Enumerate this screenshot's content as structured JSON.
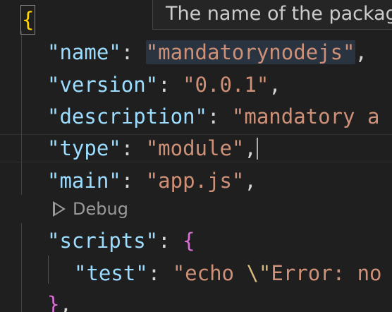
{
  "editor": {
    "hover_tooltip": "The name of the package.",
    "code_lens": {
      "label": "Debug",
      "icon": "debug-play-icon"
    },
    "lines": {
      "open_brace": "{",
      "name": {
        "key": "\"name\"",
        "sep": ": ",
        "value": "\"mandatorynodejs\"",
        "trail": ","
      },
      "version": {
        "key": "\"version\"",
        "sep": ": ",
        "value": "\"0.0.1\"",
        "trail": ","
      },
      "description": {
        "key": "\"description\"",
        "sep": ": ",
        "value": "\"mandatory a"
      },
      "type": {
        "key": "\"type\"",
        "sep": ": ",
        "value": "\"module\"",
        "trail": ","
      },
      "main": {
        "key": "\"main\"",
        "sep": ": ",
        "value": "\"app.js\"",
        "trail": ","
      },
      "scripts": {
        "key": "\"scripts\"",
        "sep": ": ",
        "open": "{"
      },
      "test": {
        "key": "\"test\"",
        "sep": ": ",
        "value_start": "\"echo ",
        "escape": "\\\"",
        "value_rest": "Error: no"
      },
      "close_scripts": {
        "close": "}",
        "trail": ","
      }
    },
    "colors": {
      "background": "#1f1f1f",
      "key": "#9cdcfe",
      "string": "#ce9178",
      "brace_gold": "#ffd700",
      "brace_purple": "#da70d6",
      "escape": "#d7ba7d"
    }
  }
}
